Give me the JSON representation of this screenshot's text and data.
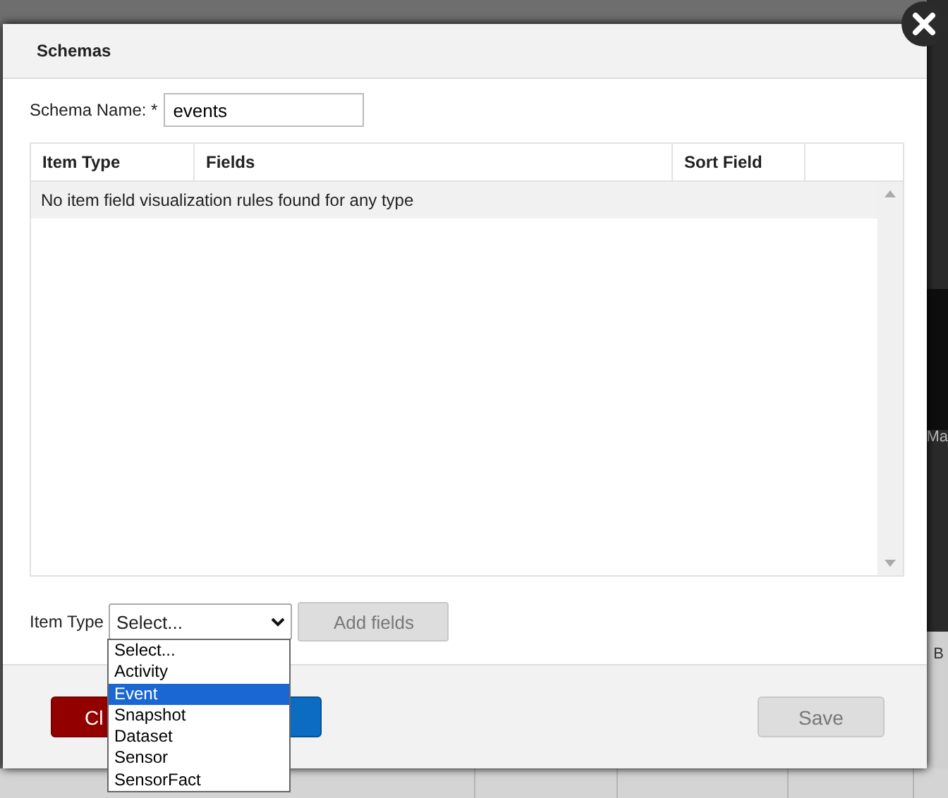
{
  "background": {
    "texts": [
      "Ma",
      "B"
    ]
  },
  "dialog": {
    "title": "Schemas",
    "schema_name": {
      "label": "Schema Name: *",
      "value": "events"
    },
    "table": {
      "columns": [
        "Item Type",
        "Fields",
        "Sort Field"
      ],
      "empty_message": "No item field visualization rules found for any type"
    },
    "item_type": {
      "label": "Item Type",
      "value": "Select...",
      "add_button": {
        "label": "Add fields",
        "disabled": true
      },
      "options": [
        {
          "label": "Select...",
          "highlighted": false
        },
        {
          "label": "Activity",
          "highlighted": false
        },
        {
          "label": "Event",
          "highlighted": true
        },
        {
          "label": "Snapshot",
          "highlighted": false
        },
        {
          "label": "Dataset",
          "highlighted": false
        },
        {
          "label": "Sensor",
          "highlighted": false
        },
        {
          "label": "SensorFact",
          "highlighted": false
        }
      ]
    },
    "footer": {
      "buttons": [
        {
          "kind": "danger",
          "label": "Cl"
        },
        {
          "kind": "primary"
        },
        {
          "kind": "save",
          "label": "Save",
          "disabled": true
        }
      ]
    }
  }
}
